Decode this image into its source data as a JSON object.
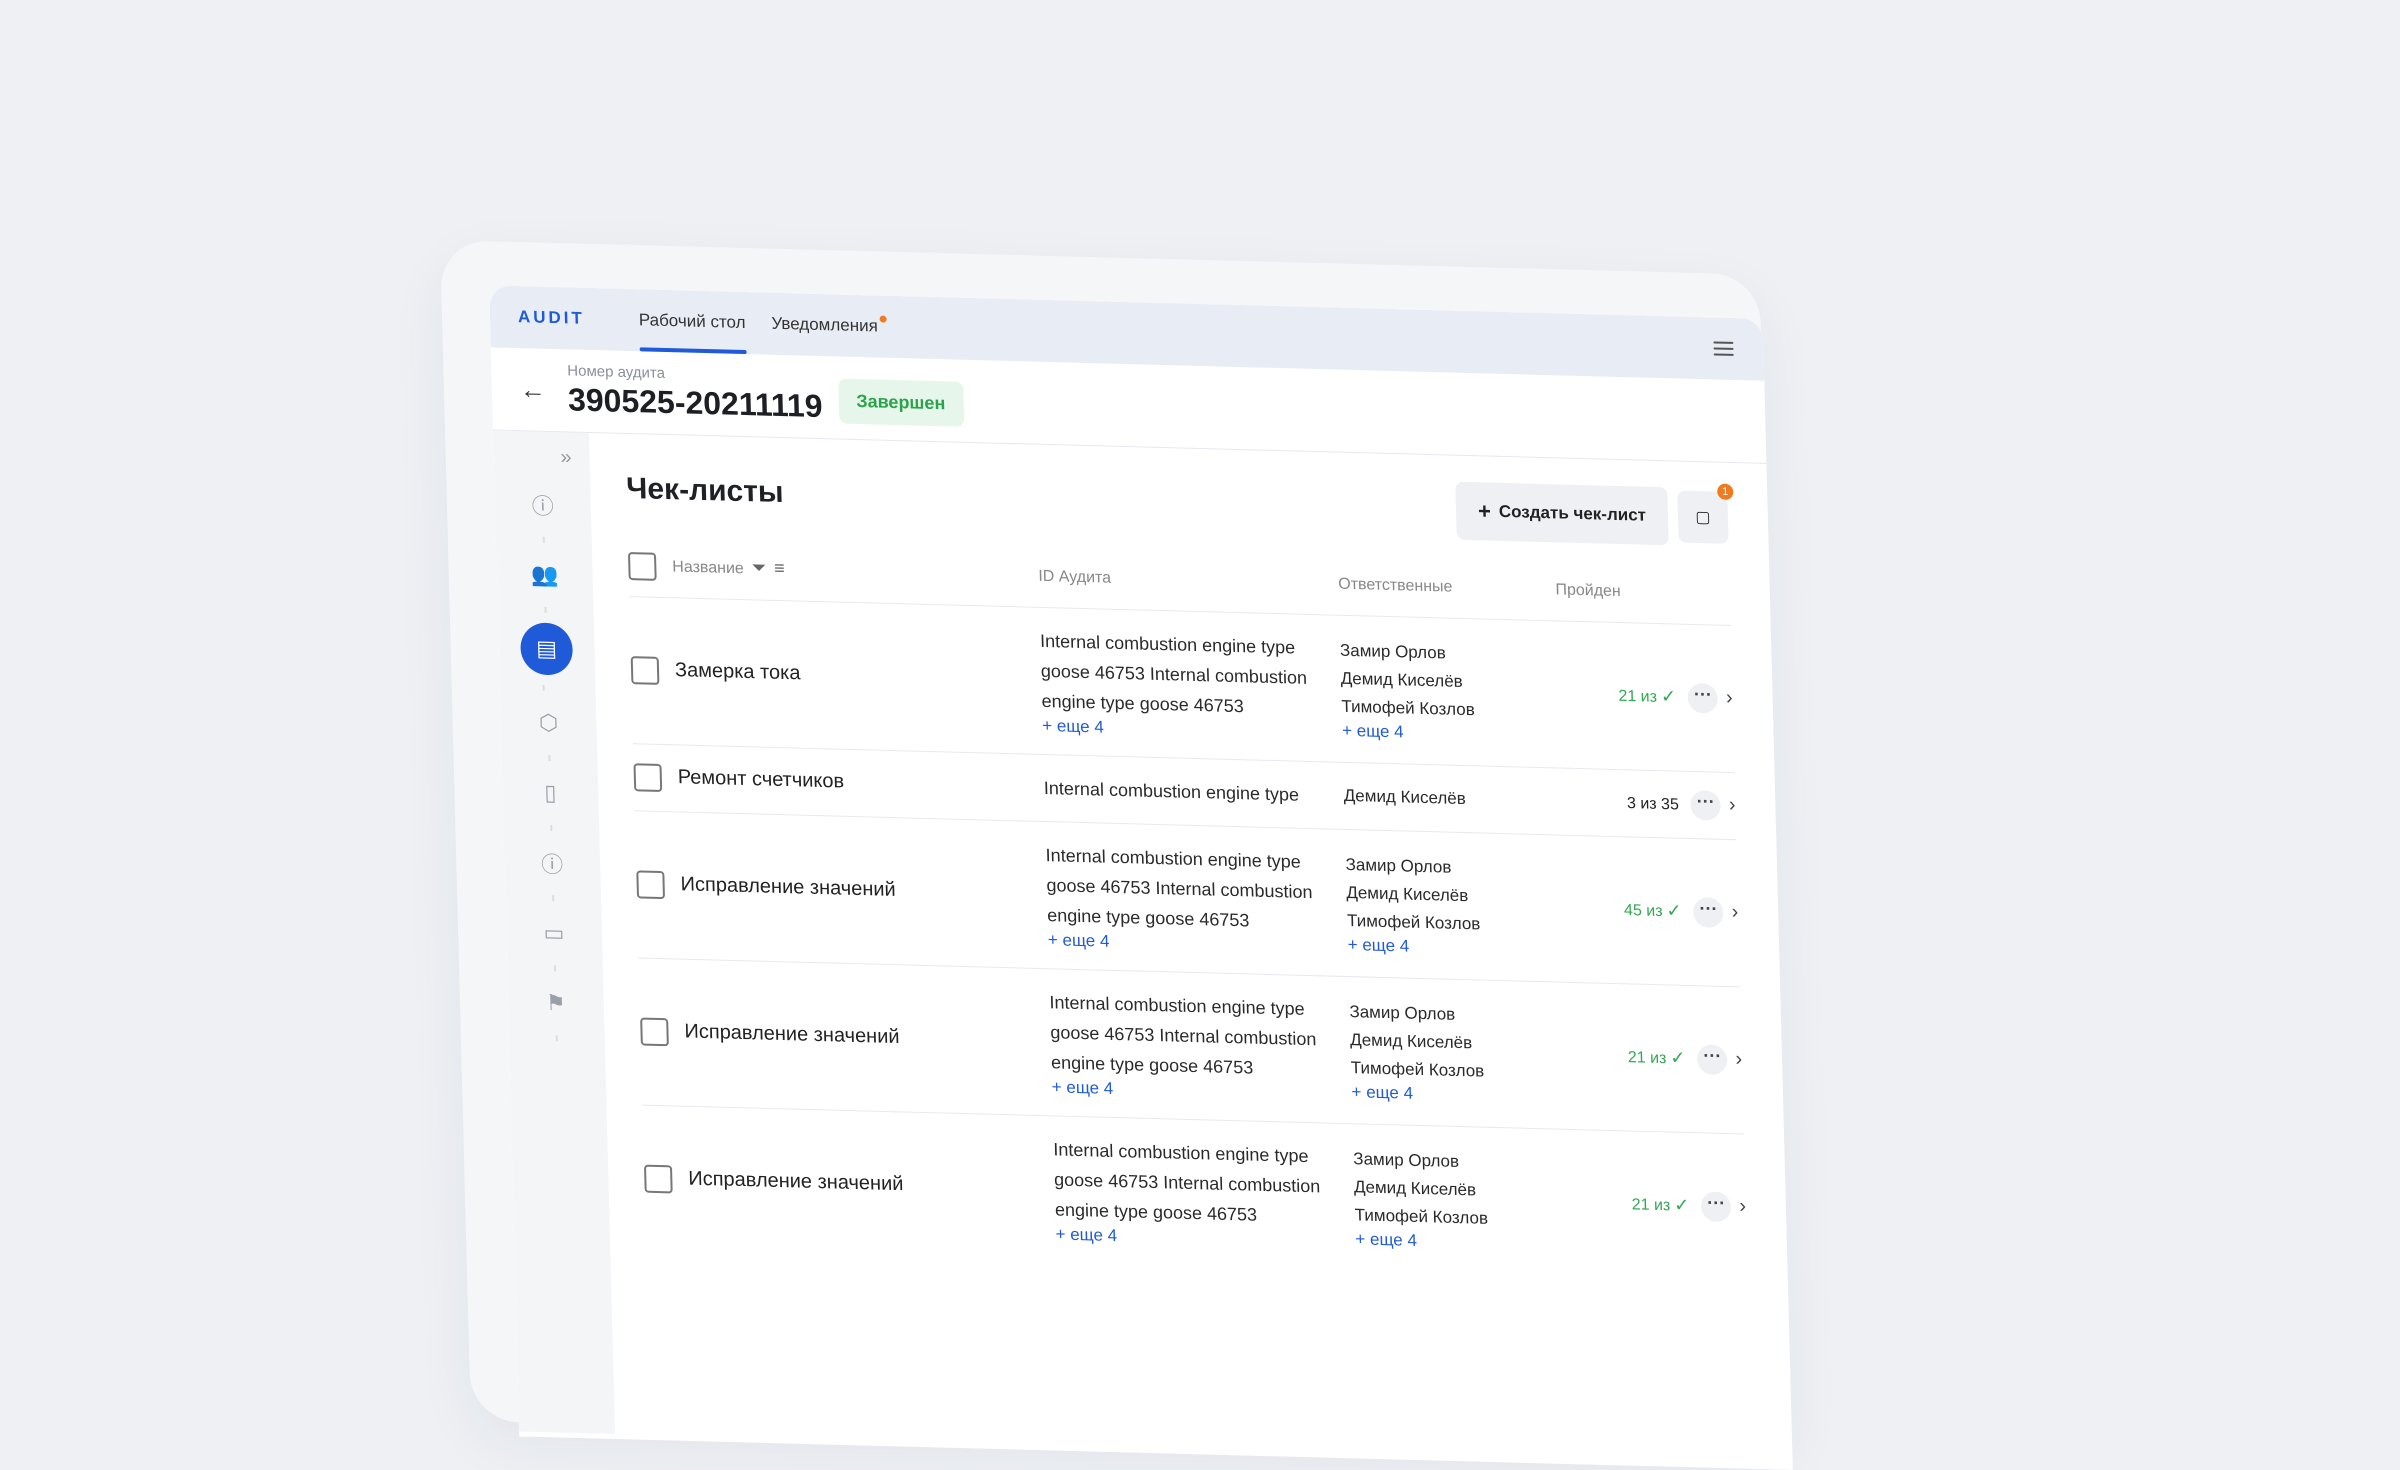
{
  "app": {
    "logo": "AUDIT"
  },
  "topbar": {
    "tabs": [
      "Рабочий стол",
      "Уведомления"
    ]
  },
  "audit": {
    "label": "Номер аудита",
    "number": "390525-20211119",
    "status": "Завершен"
  },
  "sidebar": {
    "collapse_icon": "double-chevron-right-icon",
    "icons": [
      "info-icon",
      "users-icon",
      "document-icon",
      "box-icon",
      "clipboard-icon",
      "alert-icon",
      "file-icon",
      "flag-icon"
    ],
    "active_index": 2
  },
  "checklists": {
    "title": "Чек-листы",
    "create_label": "Создать чек-лист",
    "chat_count": "1",
    "columns": {
      "name": "Название",
      "audit_id": "ID Аудита",
      "responsible": "Ответственные",
      "passed": "Пройден"
    },
    "rows": [
      {
        "name": "Замерка тока",
        "audit_id": "Internal combustion engine type goose 46753 Internal combustion engine type goose 46753",
        "audit_more": "+ еще 4",
        "responsible": [
          "Замир Орлов",
          "Демид Киселёв",
          "Тимофей Козлов"
        ],
        "resp_more": "+ еще 4",
        "passed": "21 из",
        "passed_status": "green"
      },
      {
        "name": "Ремонт счетчиков",
        "audit_id": "Internal combustion engine type",
        "audit_more": "",
        "responsible": [
          "Демид Киселёв"
        ],
        "resp_more": "",
        "passed": "3 из 35",
        "passed_status": "neutral"
      },
      {
        "name": "Исправление значений",
        "audit_id": "Internal combustion engine type goose 46753 Internal combustion engine type goose 46753",
        "audit_more": "+ еще 4",
        "responsible": [
          "Замир Орлов",
          "Демид Киселёв",
          "Тимофей Козлов"
        ],
        "resp_more": "+ еще 4",
        "passed": "45 из",
        "passed_status": "green"
      },
      {
        "name": "Исправление значений",
        "audit_id": "Internal combustion engine type goose 46753 Internal combustion engine type goose 46753",
        "audit_more": "+ еще 4",
        "responsible": [
          "Замир Орлов",
          "Демид Киселёв",
          "Тимофей Козлов"
        ],
        "resp_more": "+ еще 4",
        "passed": "21 из",
        "passed_status": "green"
      },
      {
        "name": "Исправление значений",
        "audit_id": "Internal combustion engine type goose 46753 Internal combustion engine type goose 46753",
        "audit_more": "+ еще 4",
        "responsible": [
          "Замир Орлов",
          "Демид Киселёв",
          "Тимофей Козлов"
        ],
        "resp_more": "+ еще 4",
        "passed": "21 из",
        "passed_status": "green"
      }
    ]
  },
  "colors": {
    "accent": "#1f5bd8",
    "success": "#32a852",
    "badge_bg": "#e6f6ea",
    "notify": "#f07a1f"
  }
}
